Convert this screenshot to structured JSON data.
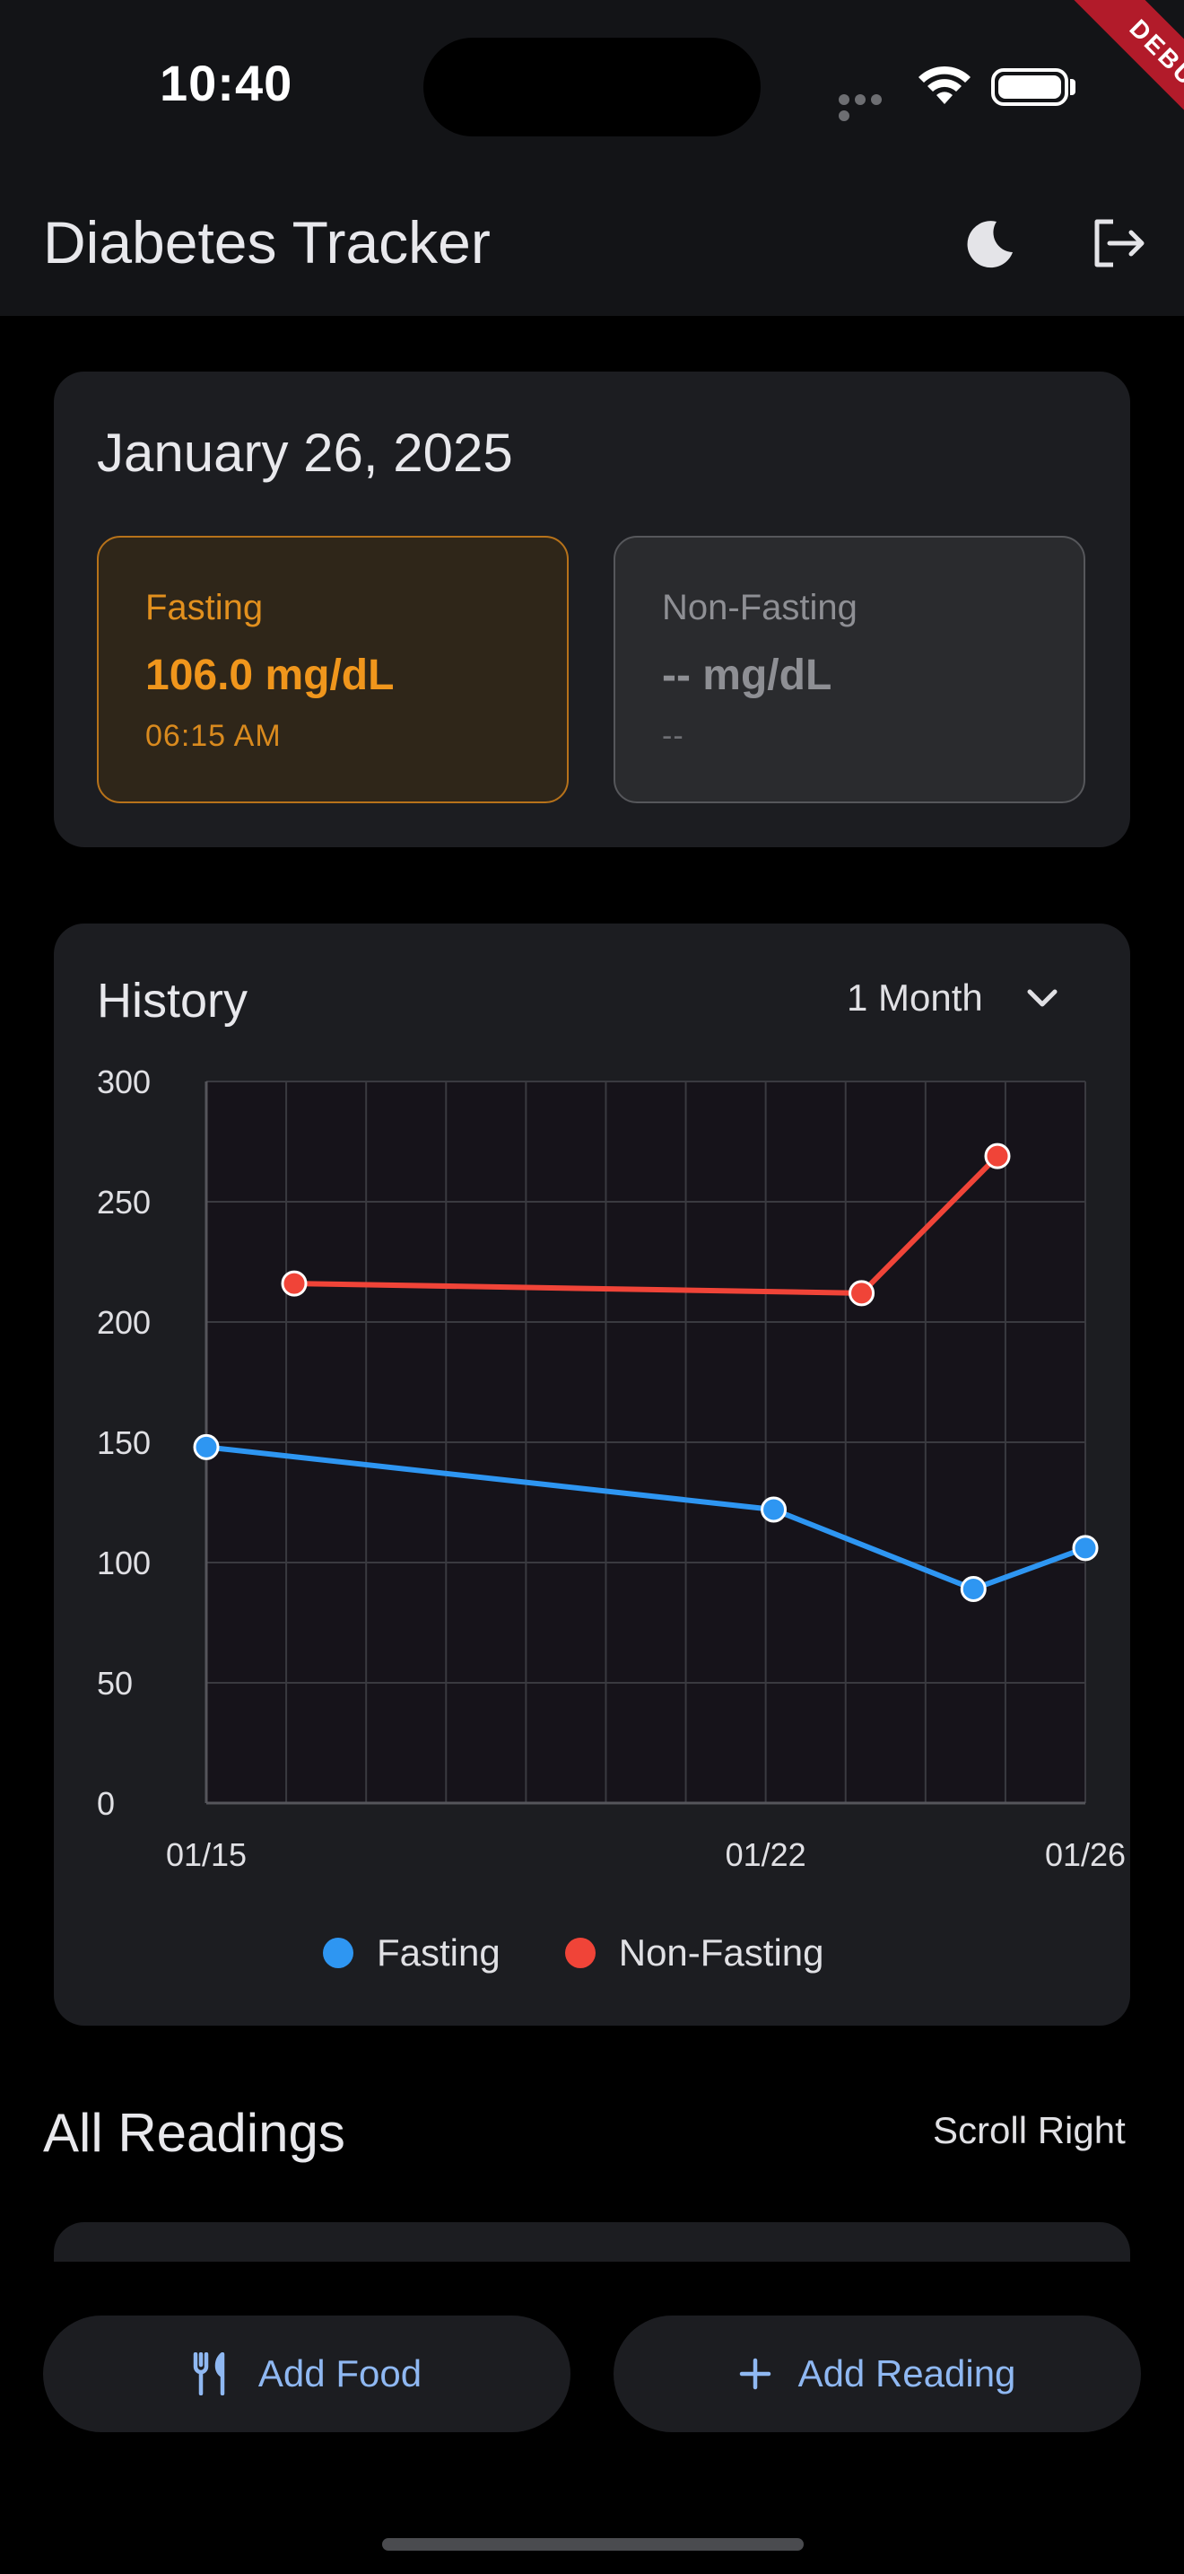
{
  "status_bar": {
    "time": "10:40",
    "debug_label": "DEBUG"
  },
  "app_bar": {
    "title": "Diabetes Tracker",
    "theme_icon": "moon-icon",
    "logout_icon": "logout-icon"
  },
  "today": {
    "date": "January 26, 2025",
    "fasting": {
      "label": "Fasting",
      "value": "106.0 mg/dL",
      "time": "06:15 AM"
    },
    "non_fasting": {
      "label": "Non-Fasting",
      "value": "-- mg/dL",
      "time": "--"
    }
  },
  "history": {
    "title": "History",
    "range": "1 Month",
    "range_icon": "chevron-down-icon"
  },
  "chart_data": {
    "type": "line",
    "ylim": [
      0,
      300
    ],
    "y_ticks": [
      "0",
      "50",
      "100",
      "150",
      "200",
      "250",
      "300"
    ],
    "x_ticks": [
      {
        "label": "01/15",
        "day": 15
      },
      {
        "label": "01/22",
        "day": 22
      },
      {
        "label": "01/26",
        "day": 26
      }
    ],
    "xlim_days": [
      15,
      26
    ],
    "grid": true,
    "series": [
      {
        "name": "Fasting",
        "color": "#2e96f2",
        "points": [
          [
            15,
            148
          ],
          [
            22.1,
            122
          ],
          [
            24.6,
            89
          ],
          [
            26,
            106
          ]
        ]
      },
      {
        "name": "Non-Fasting",
        "color": "#f04438",
        "points": [
          [
            16.1,
            216
          ],
          [
            23.2,
            212
          ],
          [
            24.9,
            269
          ]
        ]
      }
    ],
    "legend": "bottom-center"
  },
  "all_readings": {
    "title": "All Readings",
    "hint": "Scroll Right"
  },
  "actions": {
    "add_food": "Add Food",
    "add_food_icon": "fork-knife-icon",
    "add_reading": "Add Reading",
    "add_reading_icon": "plus-icon"
  }
}
